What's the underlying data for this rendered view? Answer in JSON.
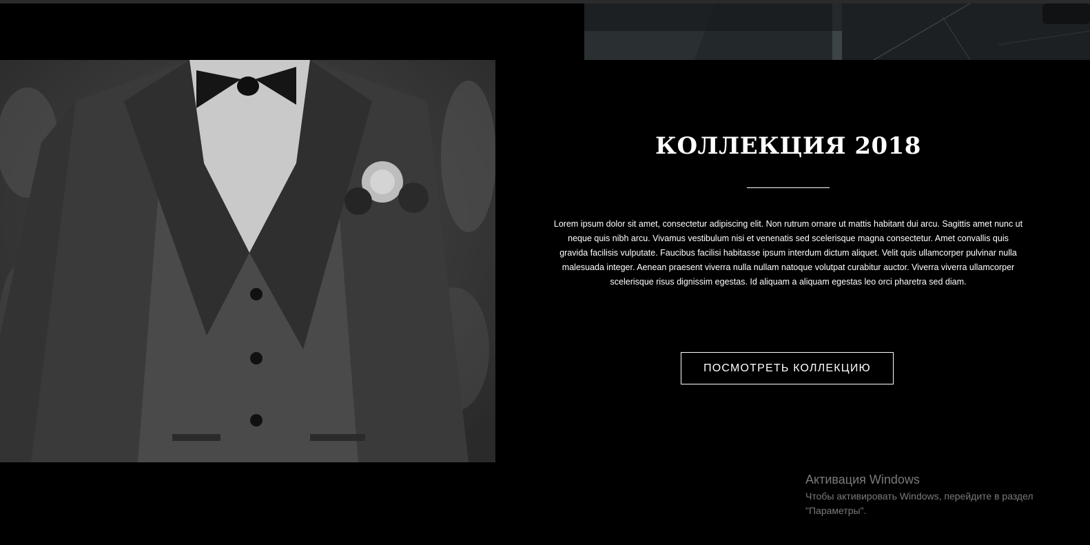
{
  "collection": {
    "title": "КОЛЛЕКЦИЯ 2018",
    "description": "Lorem ipsum dolor sit amet, consectetur adipiscing elit. Non rutrum ornare ut mattis habitant dui arcu. Sagittis amet nunc ut neque quis nibh arcu. Vivamus vestibulum nisi et venenatis sed scelerisque magna consectetur. Amet convallis quis gravida facilisis vulputate. Faucibus facilisi habitasse ipsum interdum dictum aliquet. Velit quis ullamcorper pulvinar nulla malesuada integer. Aenean praesent viverra nulla nullam natoque volutpat curabitur auctor. Viverra viverra ullamcorper scelerisque risus dignissim egestas. Id aliquam a aliquam egestas leo orci pharetra sed diam.",
    "button_label": "ПОСМОТРЕТЬ КОЛЛЕКЦИЮ"
  },
  "windows_activation": {
    "title": "Активация Windows",
    "line1": "Чтобы активировать Windows, перейдите в раздел",
    "line2": "\"Параметры\"."
  },
  "colors": {
    "background": "#000000",
    "text": "#ffffff",
    "watermark": "#7a7a7a"
  }
}
